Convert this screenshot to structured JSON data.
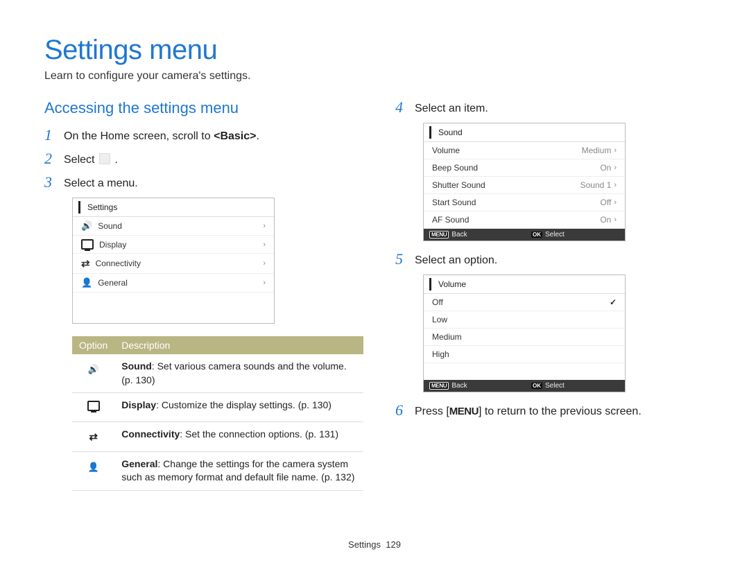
{
  "title": "Settings menu",
  "subtitle": "Learn to configure your camera's settings.",
  "section_heading": "Accessing the settings menu",
  "left_steps": {
    "s1_pre": "On the Home screen, scroll to ",
    "s1_bold": "<Basic>",
    "s1_post": ".",
    "s2_pre": "Select ",
    "s2_post": " .",
    "s3": "Select a menu."
  },
  "settings_screen": {
    "header": "Settings",
    "rows": [
      {
        "icon": "sound",
        "label": "Sound"
      },
      {
        "icon": "display",
        "label": "Display"
      },
      {
        "icon": "conn",
        "label": "Connectivity"
      },
      {
        "icon": "general",
        "label": "General"
      }
    ]
  },
  "desc_table": {
    "headers": {
      "option": "Option",
      "desc": "Description"
    },
    "rows": [
      {
        "icon": "sound",
        "bold": "Sound",
        "text": ": Set various camera sounds and the volume. ",
        "page": "(p. 130)"
      },
      {
        "icon": "display",
        "bold": "Display",
        "text": ": Customize the display settings. ",
        "page": "(p. 130)"
      },
      {
        "icon": "conn",
        "bold": "Connectivity",
        "text": ": Set the connection options. ",
        "page": "(p. 131)"
      },
      {
        "icon": "general",
        "bold": "General",
        "text": ": Change the settings for the camera system such as memory format and default file name. ",
        "page": "(p. 132)"
      }
    ]
  },
  "right": {
    "s4": "Select an item.",
    "s5": "Select an option.",
    "s6_pre": "Press [",
    "s6_btn": "MENU",
    "s6_post": "] to return to the previous screen."
  },
  "sound_screen": {
    "header": "Sound",
    "rows": [
      {
        "label": "Volume",
        "value": "Medium"
      },
      {
        "label": "Beep Sound",
        "value": "On"
      },
      {
        "label": "Shutter Sound",
        "value": "Sound 1"
      },
      {
        "label": "Start Sound",
        "value": "Off"
      },
      {
        "label": "AF Sound",
        "value": "On"
      }
    ],
    "footer": {
      "back_btn": "MENU",
      "back_label": "Back",
      "sel_btn": "OK",
      "sel_label": "Select"
    }
  },
  "volume_screen": {
    "header": "Volume",
    "rows": [
      {
        "label": "Off",
        "selected": true
      },
      {
        "label": "Low",
        "selected": false
      },
      {
        "label": "Medium",
        "selected": false
      },
      {
        "label": "High",
        "selected": false
      }
    ],
    "footer": {
      "back_btn": "MENU",
      "back_label": "Back",
      "sel_btn": "OK",
      "sel_label": "Select"
    }
  },
  "footer": {
    "section": "Settings",
    "page": "129"
  }
}
